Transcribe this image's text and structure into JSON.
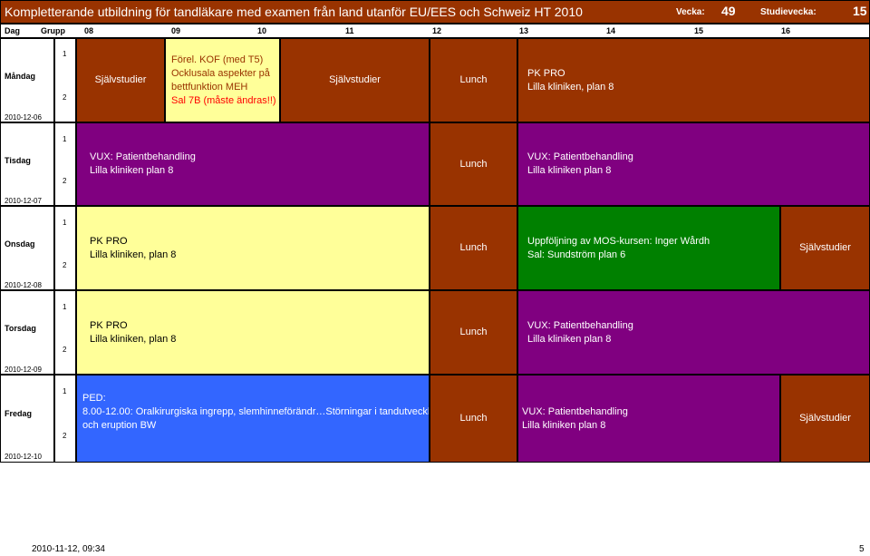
{
  "title": "Kompletterande utbildning för tandläkare med examen från land utanför EU/EES och Schweiz HT 2010",
  "vecka_label": "Vecka:",
  "vecka_value": "49",
  "studievecka_label": "Studievecka:",
  "studievecka_value": "15",
  "header": {
    "dag": "Dag",
    "grupp": "Grupp",
    "hours": [
      "08",
      "09",
      "10",
      "11",
      "12",
      "13",
      "14",
      "15",
      "16"
    ]
  },
  "days": [
    {
      "name": "Måndag",
      "date": "2010-12-06",
      "groups": [
        "1",
        "2"
      ],
      "blocks": [
        {
          "lines": [
            "Självstudier"
          ]
        },
        {
          "lines": [
            "Förel. KOF (med T5)",
            "Ocklusala aspekter på",
            "bettfunktion MEH",
            "Sal 7B (måste ändras!!)"
          ]
        },
        {
          "lines": [
            "Självstudier"
          ]
        },
        {
          "lines": [
            "Lunch"
          ]
        },
        {
          "lines": [
            "PK PRO",
            "Lilla kliniken, plan 8"
          ]
        }
      ]
    },
    {
      "name": "Tisdag",
      "date": "2010-12-07",
      "groups": [
        "1",
        "2"
      ],
      "blocks": [
        {
          "lines": [
            "VUX: Patientbehandling",
            "Lilla kliniken plan 8"
          ]
        },
        {
          "lines": [
            "Lunch"
          ]
        },
        {
          "lines": [
            "VUX: Patientbehandling",
            "Lilla kliniken plan 8"
          ]
        }
      ]
    },
    {
      "name": "Onsdag",
      "date": "2010-12-08",
      "groups": [
        "1",
        "2"
      ],
      "blocks": [
        {
          "lines": [
            "PK PRO",
            "Lilla kliniken, plan 8"
          ]
        },
        {
          "lines": [
            "Lunch"
          ]
        },
        {
          "lines": [
            "Uppföljning av MOS-kursen: Inger Wårdh",
            "Sal: Sundström plan 6"
          ]
        },
        {
          "lines": [
            "Självstudier"
          ]
        }
      ]
    },
    {
      "name": "Torsdag",
      "date": "2010-12-09",
      "groups": [
        "1",
        "2"
      ],
      "blocks": [
        {
          "lines": [
            "PK PRO",
            "Lilla kliniken, plan 8"
          ]
        },
        {
          "lines": [
            "Lunch"
          ]
        },
        {
          "lines": [
            "VUX: Patientbehandling",
            "Lilla kliniken plan 8"
          ]
        }
      ]
    },
    {
      "name": "Fredag",
      "date": "2010-12-10",
      "groups": [
        "1",
        "2"
      ],
      "blocks": [
        {
          "lines": [
            "PED:",
            "8.00-12.00: Oralkirurgiska ingrepp, slemhinneförändr…Störningar i tandutveckling",
            "och eruption BW"
          ]
        },
        {
          "lines": [
            "Lunch"
          ]
        },
        {
          "lines": [
            "VUX: Patientbehandling",
            "Lilla kliniken plan 8"
          ]
        },
        {
          "lines": [
            "Självstudier"
          ]
        }
      ]
    }
  ],
  "footer": {
    "timestamp": "2010-11-12, 09:34",
    "page": "5"
  },
  "colors": {
    "brown": "#993300",
    "light_yellow": "#ffff99",
    "purple": "#800080",
    "green": "#008000",
    "blue": "#3366ff"
  }
}
